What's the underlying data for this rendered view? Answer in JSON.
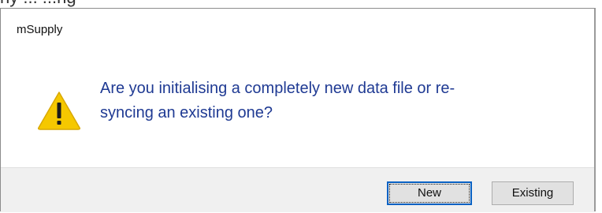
{
  "background_fragment": "ny       ...   ...ng",
  "dialog": {
    "title": "mSupply",
    "icon": "warning-icon",
    "message": "Are you initialising a completely new data file or re-syncing an existing one?",
    "message_line1": "Are you initialising a completely new data file or re-",
    "message_line2": "syncing an existing one?",
    "buttons": {
      "new": "New",
      "existing": "Existing"
    },
    "default_button": "New"
  },
  "colors": {
    "message_text": "#1f3a93",
    "warning_fill": "#f5c800",
    "default_button_border": "#0a62c4",
    "footer_bg": "#f0f0f0"
  }
}
